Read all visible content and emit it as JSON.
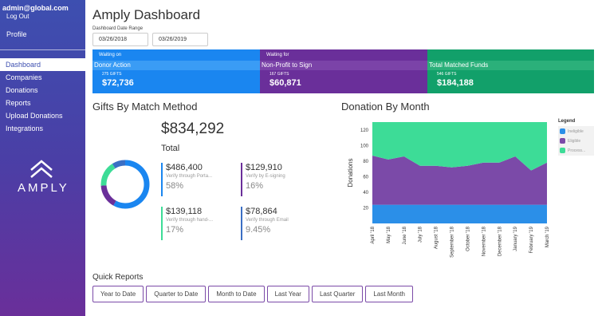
{
  "sidebar": {
    "email": "admin@global.com",
    "logout": "Log Out",
    "profile": "Profile",
    "items": [
      {
        "label": "Dashboard",
        "active": true
      },
      {
        "label": "Companies"
      },
      {
        "label": "Donations"
      },
      {
        "label": "Reports"
      },
      {
        "label": "Upload Donations"
      },
      {
        "label": "Integrations"
      }
    ],
    "brand": "AMPLY"
  },
  "header": {
    "title": "Amply Dashboard",
    "date_range_label": "Dashboard Date Range",
    "start_date": "03/26/2018",
    "end_date": "03/26/2019"
  },
  "cards": [
    {
      "top": "Waiting on",
      "title": "Donor Action",
      "gifts": "275 GIFTS",
      "amount": "$72,736",
      "color": "#1a86f0"
    },
    {
      "top": "Waiting for",
      "title": "Non-Profit to Sign",
      "gifts": "167 GIFTS",
      "amount": "$60,871",
      "color": "#6a2f9a"
    },
    {
      "top": "",
      "title": "Total Matched Funds",
      "gifts": "546 GIFTS",
      "amount": "$184,188",
      "color": "#12a06a"
    }
  ],
  "gifts_by_method": {
    "title": "Gifts By Match Method",
    "total": "$834,292",
    "total_label": "Total",
    "methods": [
      {
        "amount": "$486,400",
        "sub": "Verify through Porta...",
        "pct": "58%",
        "color": "#1a86f0"
      },
      {
        "amount": "$129,910",
        "sub": "Verify by E-signing",
        "pct": "16%",
        "color": "#6a2f9a"
      },
      {
        "amount": "$139,118",
        "sub": "Verify through hand-...",
        "pct": "17%",
        "color": "#3ddc97"
      },
      {
        "amount": "$78,864",
        "sub": "Verify through Email",
        "pct": "9.45%",
        "color": "#3b6fc4"
      }
    ]
  },
  "donation_by_month": {
    "title": "Donation By Month",
    "legend_title": "Legend",
    "legend": [
      {
        "label": "Ineligible",
        "color": "#2b8fe8"
      },
      {
        "label": "Eligible",
        "color": "#7b4aa8"
      },
      {
        "label": "Process...",
        "color": "#3ddc97"
      }
    ]
  },
  "chart_data": {
    "type": "area",
    "title": "Donation By Month",
    "xlabel": "",
    "ylabel": "Donations",
    "x": [
      "April '18",
      "May '18",
      "June '18",
      "July '18",
      "August '18",
      "September '18",
      "October '18",
      "November '18",
      "December '18",
      "January '19",
      "February '19",
      "March '19"
    ],
    "ylim": [
      0,
      130
    ],
    "yticks": [
      20,
      40,
      60,
      80,
      100,
      120
    ],
    "stacked": true,
    "series": [
      {
        "name": "Ineligible",
        "values": [
          24,
          24,
          24,
          24,
          24,
          24,
          24,
          24,
          24,
          24,
          24,
          24
        ],
        "color": "#2b8fe8"
      },
      {
        "name": "Eligible",
        "values": [
          63,
          58,
          62,
          50,
          50,
          48,
          50,
          54,
          54,
          62,
          44,
          54
        ],
        "color": "#7b4aa8"
      },
      {
        "name": "Process...",
        "values": [
          43,
          48,
          44,
          56,
          56,
          58,
          56,
          52,
          52,
          44,
          62,
          52
        ],
        "color": "#3ddc97"
      }
    ],
    "legend": "right"
  },
  "quick_reports": {
    "title": "Quick Reports",
    "buttons": [
      "Year to Date",
      "Quarter to Date",
      "Month to Date",
      "Last Year",
      "Last Quarter",
      "Last Month"
    ]
  },
  "colors": {
    "sidebar": "#4a3fa6",
    "blue": "#1a86f0",
    "purple": "#6a2f9a",
    "green": "#12a06a"
  }
}
